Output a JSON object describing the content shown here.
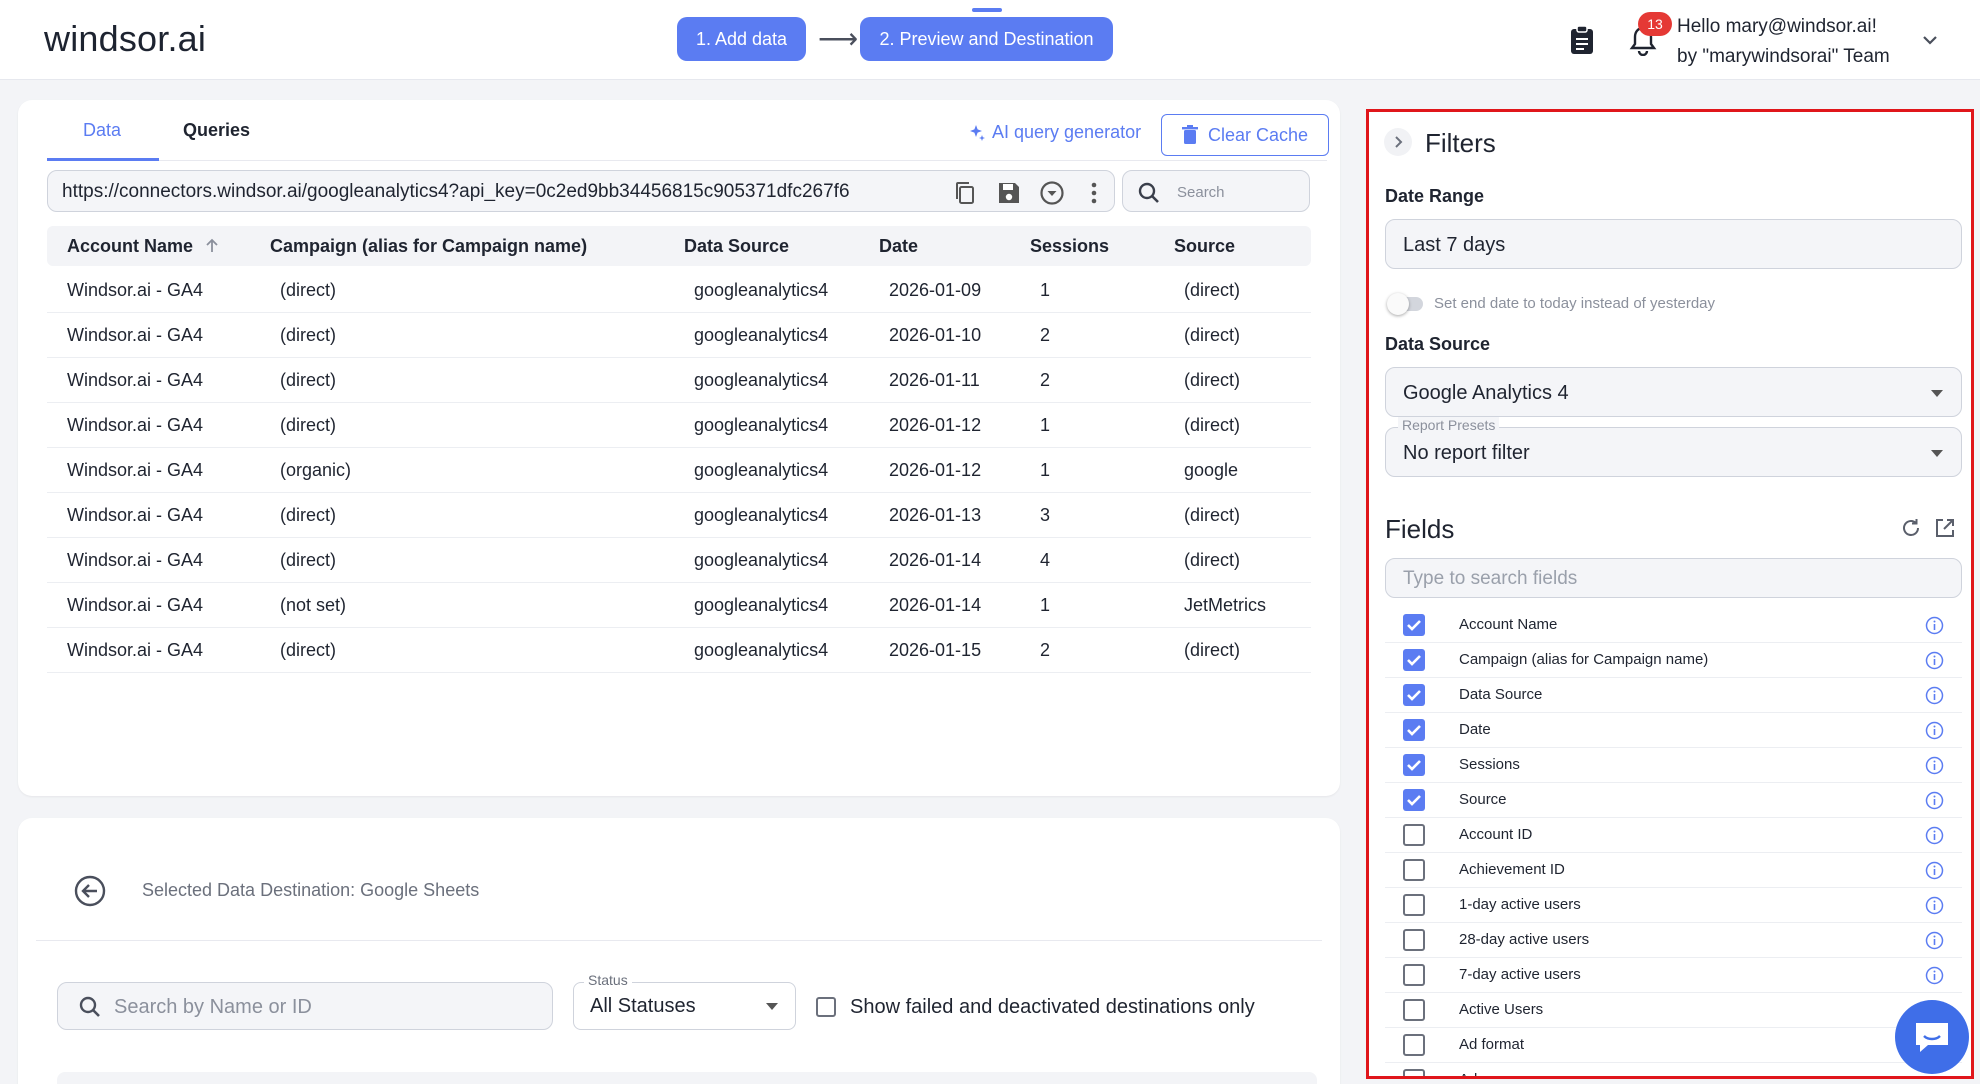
{
  "header": {
    "logo": "windsor.ai",
    "steps": [
      {
        "label": "1. Add data"
      },
      {
        "label": "2. Preview and Destination"
      }
    ],
    "arrow": "⟶",
    "notifications_count": "13",
    "greeting_line1": "Hello mary@windsor.ai!",
    "greeting_line2": "by \"marywindsorai\" Team"
  },
  "data_panel": {
    "tabs": [
      "Data",
      "Queries"
    ],
    "ai_query_label": "AI query generator",
    "clear_cache_label": "Clear Cache",
    "url": "https://connectors.windsor.ai/googleanalytics4?api_key=0c2ed9bb34456815c905371dfc267f6",
    "search_placeholder": "Search",
    "columns": [
      "Account Name",
      "Campaign (alias for Campaign name)",
      "Data Source",
      "Date",
      "Sessions",
      "Source"
    ],
    "rows": [
      [
        "Windsor.ai - GA4",
        "(direct)",
        "googleanalytics4",
        "2026-01-09",
        "1",
        "(direct)"
      ],
      [
        "Windsor.ai - GA4",
        "(direct)",
        "googleanalytics4",
        "2026-01-10",
        "2",
        "(direct)"
      ],
      [
        "Windsor.ai - GA4",
        "(direct)",
        "googleanalytics4",
        "2026-01-11",
        "2",
        "(direct)"
      ],
      [
        "Windsor.ai - GA4",
        "(direct)",
        "googleanalytics4",
        "2026-01-12",
        "1",
        "(direct)"
      ],
      [
        "Windsor.ai - GA4",
        "(organic)",
        "googleanalytics4",
        "2026-01-12",
        "1",
        "google"
      ],
      [
        "Windsor.ai - GA4",
        "(direct)",
        "googleanalytics4",
        "2026-01-13",
        "3",
        "(direct)"
      ],
      [
        "Windsor.ai - GA4",
        "(direct)",
        "googleanalytics4",
        "2026-01-14",
        "4",
        "(direct)"
      ],
      [
        "Windsor.ai - GA4",
        "(not set)",
        "googleanalytics4",
        "2026-01-14",
        "1",
        "JetMetrics"
      ],
      [
        "Windsor.ai - GA4",
        "(direct)",
        "googleanalytics4",
        "2026-01-15",
        "2",
        "(direct)"
      ]
    ]
  },
  "destination": {
    "selected_text": "Selected Data Destination: Google Sheets",
    "search_placeholder": "Search by Name or ID",
    "status_label": "Status",
    "status_value": "All Statuses",
    "failed_only_label": "Show failed and deactivated destinations only",
    "failed_only_checked": false
  },
  "filters": {
    "title": "Filters",
    "date_range_label": "Date Range",
    "date_range_value": "Last 7 days",
    "end_date_toggle_label": "Set end date to today instead of yesterday",
    "end_date_toggle_on": false,
    "data_source_label": "Data Source",
    "data_source_value": "Google Analytics 4",
    "report_presets_label": "Report Presets",
    "report_presets_value": "No report filter",
    "fields_title": "Fields",
    "field_search_placeholder": "Type to search fields",
    "fields": [
      {
        "name": "Account Name",
        "checked": true
      },
      {
        "name": "Campaign (alias for Campaign name)",
        "checked": true
      },
      {
        "name": "Data Source",
        "checked": true
      },
      {
        "name": "Date",
        "checked": true
      },
      {
        "name": "Sessions",
        "checked": true
      },
      {
        "name": "Source",
        "checked": true
      },
      {
        "name": "Account ID",
        "checked": false
      },
      {
        "name": "Achievement ID",
        "checked": false
      },
      {
        "name": "1-day active users",
        "checked": false
      },
      {
        "name": "28-day active users",
        "checked": false
      },
      {
        "name": "7-day active users",
        "checked": false
      },
      {
        "name": "Active Users",
        "checked": false
      },
      {
        "name": "Ad format",
        "checked": false
      },
      {
        "name": "Ad source",
        "checked": false
      }
    ]
  },
  "colors": {
    "accent": "#5b7cf2",
    "highlight_border": "#e0161b",
    "badge": "#e53935",
    "chat": "#3f6ee8"
  },
  "icons": [
    "clipboard-icon",
    "bell-icon",
    "chevron-down-icon",
    "sparkle-icon",
    "trash-icon",
    "copy-icon",
    "save-icon",
    "dropdown-circle-icon",
    "more-vertical-icon",
    "search-icon",
    "sort-up-icon",
    "back-arrow-icon",
    "chevron-right-icon",
    "refresh-icon",
    "open-external-icon",
    "info-icon",
    "chat-icon"
  ]
}
